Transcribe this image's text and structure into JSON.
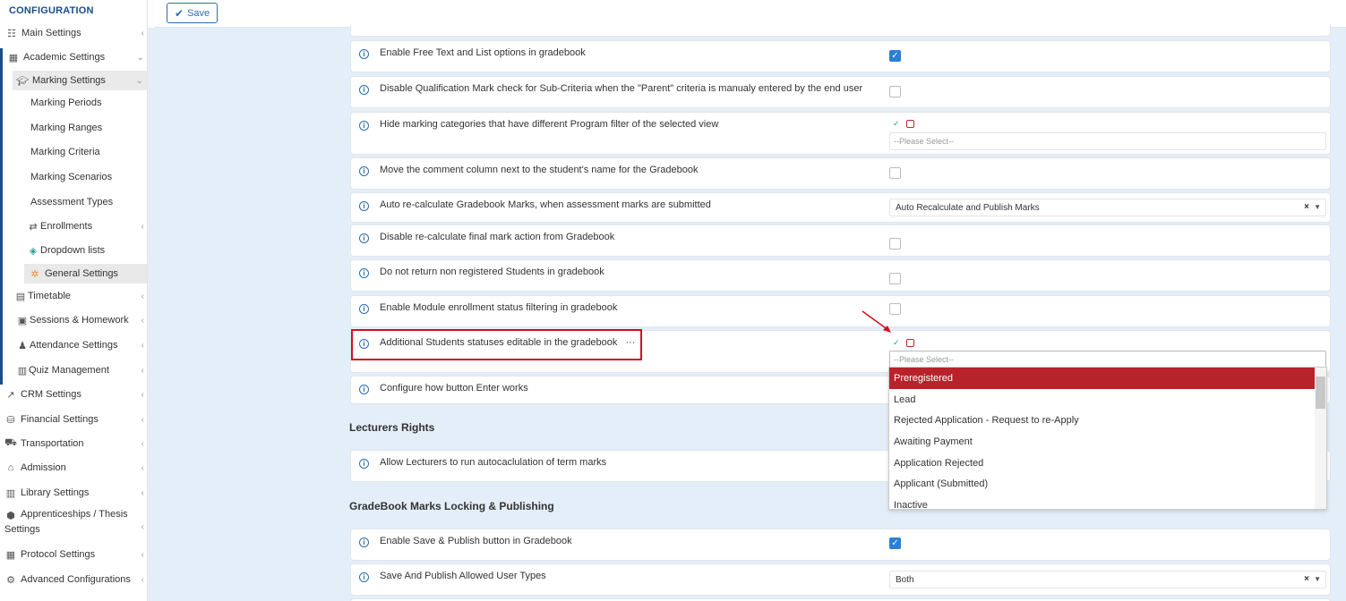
{
  "sidebar": {
    "title": "CONFIGURATION",
    "items": [
      {
        "label": "Main Settings",
        "icon": "sliders-icon"
      },
      {
        "label": "Academic Settings",
        "icon": "grid-icon"
      },
      {
        "label": "Marking Settings",
        "icon": "graduation-cap-icon"
      },
      {
        "label": "Marking Periods"
      },
      {
        "label": "Marking Ranges"
      },
      {
        "label": "Marking Criteria"
      },
      {
        "label": "Marking Scenarios"
      },
      {
        "label": "Assessment Types"
      },
      {
        "label": "Enrollments",
        "icon": "arrows-icon"
      },
      {
        "label": "Dropdown lists",
        "icon": "layers-icon"
      },
      {
        "label": "General Settings",
        "icon": "gear-icon"
      },
      {
        "label": "Timetable",
        "icon": "calendar-icon"
      },
      {
        "label": "Sessions & Homework",
        "icon": "board-icon"
      },
      {
        "label": "Attendance Settings",
        "icon": "user-check-icon"
      },
      {
        "label": "Quiz Management",
        "icon": "book-icon"
      },
      {
        "label": "CRM Settings",
        "icon": "chart-icon"
      },
      {
        "label": "Financial Settings",
        "icon": "coins-icon"
      },
      {
        "label": "Transportation",
        "icon": "bus-icon"
      },
      {
        "label": "Admission",
        "icon": "bank-icon"
      },
      {
        "label": "Library Settings",
        "icon": "books-icon"
      },
      {
        "label": "Apprenticeships / Thesis",
        "label2": "Settings",
        "icon": "box-icon"
      },
      {
        "label": "Protocol Settings",
        "icon": "protocol-icon"
      },
      {
        "label": "Advanced Configurations",
        "icon": "gears-icon"
      }
    ]
  },
  "toolbar": {
    "save_label": "Save"
  },
  "rows": [
    {
      "label": "Enable Free Text and List options in gradebook"
    },
    {
      "label": "Disable Qualification Mark check for Sub-Criteria when the \"Parent\" criteria is manualy entered by the end user"
    },
    {
      "label": "Hide marking categories that have different Program filter of the selected view",
      "placeholder": "--Please Select--"
    },
    {
      "label": "Move the comment column next to the student's name for the Gradebook"
    },
    {
      "label": "Auto re-calculate Gradebook Marks, when assessment marks are submitted",
      "value": "Auto Recalculate and Publish Marks"
    },
    {
      "label": "Disable re-calculate final mark action from Gradebook"
    },
    {
      "label": "Do not return non registered Students in gradebook"
    },
    {
      "label": "Enable Module enrollment status filtering in gradebook"
    },
    {
      "label": "Additional Students statuses editable in the gradebook",
      "ellipsis": "···",
      "placeholder": "--Please Select--"
    },
    {
      "label": "Configure how button Enter works"
    }
  ],
  "sections": {
    "lecturers": "Lecturers Rights",
    "gradebook": "GradeBook Marks Locking & Publishing"
  },
  "lecturer_rows": [
    {
      "label": "Allow Lecturers to run autocaclulation of term marks"
    }
  ],
  "gradebook_rows": [
    {
      "label": "Enable Save & Publish button in Gradebook"
    },
    {
      "label": "Save And Publish Allowed User Types",
      "value": "Both"
    }
  ],
  "dropdown": {
    "options": [
      "Preregistered",
      "Lead",
      "Rejected Application - Request to re-Apply",
      "Awaiting Payment",
      "Application Rejected",
      "Applicant (Submitted)",
      "Inactive"
    ],
    "highlighted": "Preregistered"
  },
  "colors": {
    "accent": "#2b6cb0",
    "highlight": "#b8232b",
    "annotation": "#d0101b"
  }
}
